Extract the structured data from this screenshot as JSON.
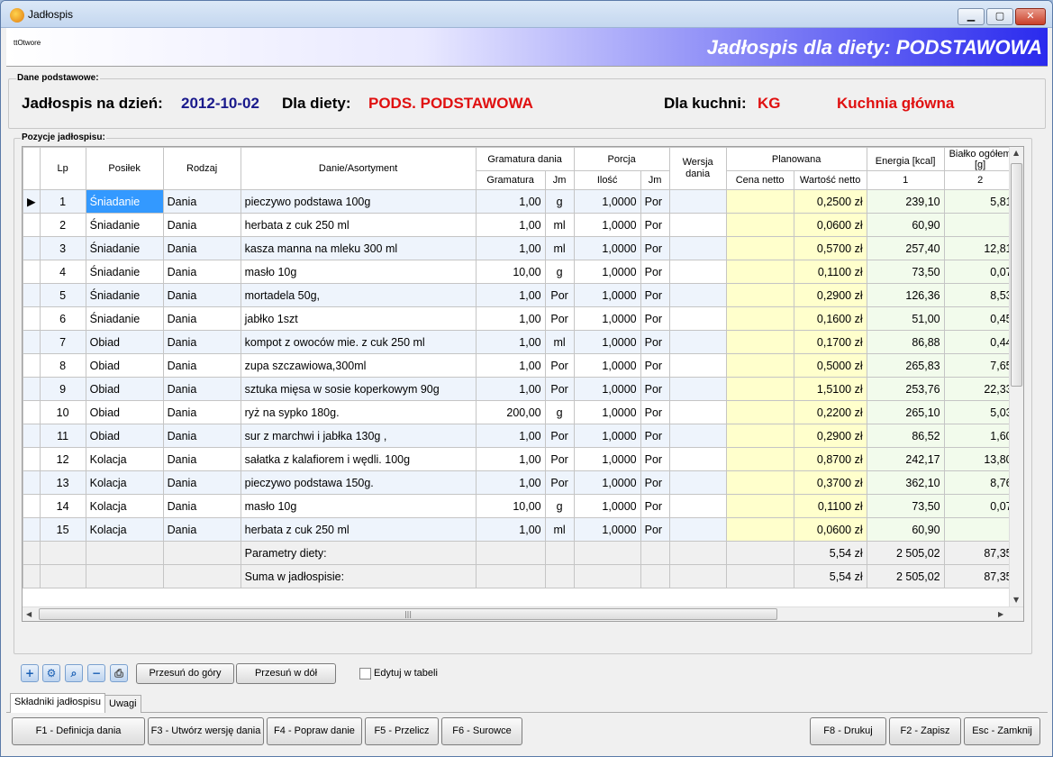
{
  "window": {
    "title": "Jadłospis",
    "min": "▁",
    "max": "▢",
    "close": "✕"
  },
  "banner": {
    "small_text": "ttOtwore",
    "title": "Jadłospis dla diety: PODSTAWOWA"
  },
  "basic": {
    "group_label": "Dane podstawowe:",
    "date_label": "Jadłospis na dzień:",
    "date_value": "2012-10-02",
    "diet_label": "Dla diety:",
    "diet_value": "PODS. PODSTAWOWA",
    "kitchen_label": "Dla kuchni:",
    "kitchen_code": "KG",
    "kitchen_name": "Kuchnia główna"
  },
  "positions": {
    "group_label": "Pozycje jadłospisu:",
    "headers": {
      "lp": "Lp",
      "posilek": "Posiłek",
      "rodzaj": "Rodzaj",
      "danie": "Danie/Asortyment",
      "gramatura_dania": "Gramatura dania",
      "gramatura": "Gramatura",
      "jm1": "Jm",
      "porcja": "Porcja",
      "ilosc": "Ilość",
      "jm2": "Jm",
      "wersja": "Wersja dania",
      "planowana": "Planowana",
      "cena": "Cena netto",
      "wartosc": "Wartość netto",
      "energia": "Energia [kcal]",
      "energia_num": "1",
      "bialko": "Białko ogółem [g]",
      "bialko_num": "2"
    },
    "rows": [
      {
        "lp": "1",
        "posilek": "Śniadanie",
        "rodzaj": "Dania",
        "danie": "pieczywo  podstawa 100g",
        "gramatura": "1,00",
        "jm": "g",
        "ilosc": "1,0000",
        "jm2": "Por",
        "wersja": "",
        "cena": "",
        "wartosc": "0,2500 zł",
        "energia": "239,10",
        "bialko": "5,81"
      },
      {
        "lp": "2",
        "posilek": "Śniadanie",
        "rodzaj": "Dania",
        "danie": "herbata z cuk 250 ml",
        "gramatura": "1,00",
        "jm": "ml",
        "ilosc": "1,0000",
        "jm2": "Por",
        "wersja": "",
        "cena": "",
        "wartosc": "0,0600 zł",
        "energia": "60,90",
        "bialko": ""
      },
      {
        "lp": "3",
        "posilek": "Śniadanie",
        "rodzaj": "Dania",
        "danie": "kasza manna na mleku 300 ml",
        "gramatura": "1,00",
        "jm": "ml",
        "ilosc": "1,0000",
        "jm2": "Por",
        "wersja": "",
        "cena": "",
        "wartosc": "0,5700 zł",
        "energia": "257,40",
        "bialko": "12,81"
      },
      {
        "lp": "4",
        "posilek": "Śniadanie",
        "rodzaj": "Dania",
        "danie": "masło 10g",
        "gramatura": "10,00",
        "jm": "g",
        "ilosc": "1,0000",
        "jm2": "Por",
        "wersja": "",
        "cena": "",
        "wartosc": "0,1100 zł",
        "energia": "73,50",
        "bialko": "0,07"
      },
      {
        "lp": "5",
        "posilek": "Śniadanie",
        "rodzaj": "Dania",
        "danie": "mortadela 50g,",
        "gramatura": "1,00",
        "jm": "Por",
        "ilosc": "1,0000",
        "jm2": "Por",
        "wersja": "",
        "cena": "",
        "wartosc": "0,2900 zł",
        "energia": "126,36",
        "bialko": "8,53"
      },
      {
        "lp": "6",
        "posilek": "Śniadanie",
        "rodzaj": "Dania",
        "danie": "jabłko 1szt",
        "gramatura": "1,00",
        "jm": "Por",
        "ilosc": "1,0000",
        "jm2": "Por",
        "wersja": "",
        "cena": "",
        "wartosc": "0,1600 zł",
        "energia": "51,00",
        "bialko": "0,45"
      },
      {
        "lp": "7",
        "posilek": "Obiad",
        "rodzaj": "Dania",
        "danie": "kompot z owoców  mie. z cuk 250 ml",
        "gramatura": "1,00",
        "jm": "ml",
        "ilosc": "1,0000",
        "jm2": "Por",
        "wersja": "",
        "cena": "",
        "wartosc": "0,1700 zł",
        "energia": "86,88",
        "bialko": "0,44"
      },
      {
        "lp": "8",
        "posilek": "Obiad",
        "rodzaj": "Dania",
        "danie": "zupa szczawiowa,300ml",
        "gramatura": "1,00",
        "jm": "Por",
        "ilosc": "1,0000",
        "jm2": "Por",
        "wersja": "",
        "cena": "",
        "wartosc": "0,5000 zł",
        "energia": "265,83",
        "bialko": "7,65"
      },
      {
        "lp": "9",
        "posilek": "Obiad",
        "rodzaj": "Dania",
        "danie": "sztuka mięsa w sosie  koperkowym 90g",
        "gramatura": "1,00",
        "jm": "Por",
        "ilosc": "1,0000",
        "jm2": "Por",
        "wersja": "",
        "cena": "",
        "wartosc": "1,5100 zł",
        "energia": "253,76",
        "bialko": "22,33"
      },
      {
        "lp": "10",
        "posilek": "Obiad",
        "rodzaj": "Dania",
        "danie": "ryż na sypko 180g.",
        "gramatura": "200,00",
        "jm": "g",
        "ilosc": "1,0000",
        "jm2": "Por",
        "wersja": "",
        "cena": "",
        "wartosc": "0,2200 zł",
        "energia": "265,10",
        "bialko": "5,03"
      },
      {
        "lp": "11",
        "posilek": "Obiad",
        "rodzaj": "Dania",
        "danie": "sur z marchwi i jabłka 130g ,",
        "gramatura": "1,00",
        "jm": "Por",
        "ilosc": "1,0000",
        "jm2": "Por",
        "wersja": "",
        "cena": "",
        "wartosc": "0,2900 zł",
        "energia": "86,52",
        "bialko": "1,60"
      },
      {
        "lp": "12",
        "posilek": "Kolacja",
        "rodzaj": "Dania",
        "danie": "sałatka z kalafiorem i wędli. 100g",
        "gramatura": "1,00",
        "jm": "Por",
        "ilosc": "1,0000",
        "jm2": "Por",
        "wersja": "",
        "cena": "",
        "wartosc": "0,8700 zł",
        "energia": "242,17",
        "bialko": "13,80"
      },
      {
        "lp": "13",
        "posilek": "Kolacja",
        "rodzaj": "Dania",
        "danie": "pieczywo podstawa 150g.",
        "gramatura": "1,00",
        "jm": "Por",
        "ilosc": "1,0000",
        "jm2": "Por",
        "wersja": "",
        "cena": "",
        "wartosc": "0,3700 zł",
        "energia": "362,10",
        "bialko": "8,76"
      },
      {
        "lp": "14",
        "posilek": "Kolacja",
        "rodzaj": "Dania",
        "danie": "masło 10g",
        "gramatura": "10,00",
        "jm": "g",
        "ilosc": "1,0000",
        "jm2": "Por",
        "wersja": "",
        "cena": "",
        "wartosc": "0,1100 zł",
        "energia": "73,50",
        "bialko": "0,07"
      },
      {
        "lp": "15",
        "posilek": "Kolacja",
        "rodzaj": "Dania",
        "danie": "herbata z cuk 250 ml",
        "gramatura": "1,00",
        "jm": "ml",
        "ilosc": "1,0000",
        "jm2": "Por",
        "wersja": "",
        "cena": "",
        "wartosc": "0,0600 zł",
        "energia": "60,90",
        "bialko": ""
      }
    ],
    "footer": [
      {
        "label": "Parametry diety:",
        "wartosc": "5,54 zł",
        "energia": "2 505,02",
        "bialko": "87,35"
      },
      {
        "label": "Suma w jadłospisie:",
        "wartosc": "5,54 zł",
        "energia": "2 505,02",
        "bialko": "87,35"
      }
    ]
  },
  "toolbar": {
    "move_up": "Przesuń do góry",
    "move_down": "Przesuń w dół",
    "edit_in_table": "Edytuj w tabeli"
  },
  "tabs": [
    "Składniki jadłospisu",
    "Uwagi"
  ],
  "fkeys": {
    "f1": "F1 - Definicja dania",
    "f3": "F3 - Utwórz wersję dania",
    "f4": "F4 - Popraw danie",
    "f5": "F5 - Przelicz",
    "f6": "F6 - Surowce",
    "f8": "F8 - Drukuj",
    "f2": "F2 - Zapisz",
    "esc": "Esc - Zamknij"
  },
  "colors": {
    "date": "#1a1a8c",
    "red": "#e01010",
    "selection": "#3399ff",
    "plan": "#ffffcc"
  }
}
